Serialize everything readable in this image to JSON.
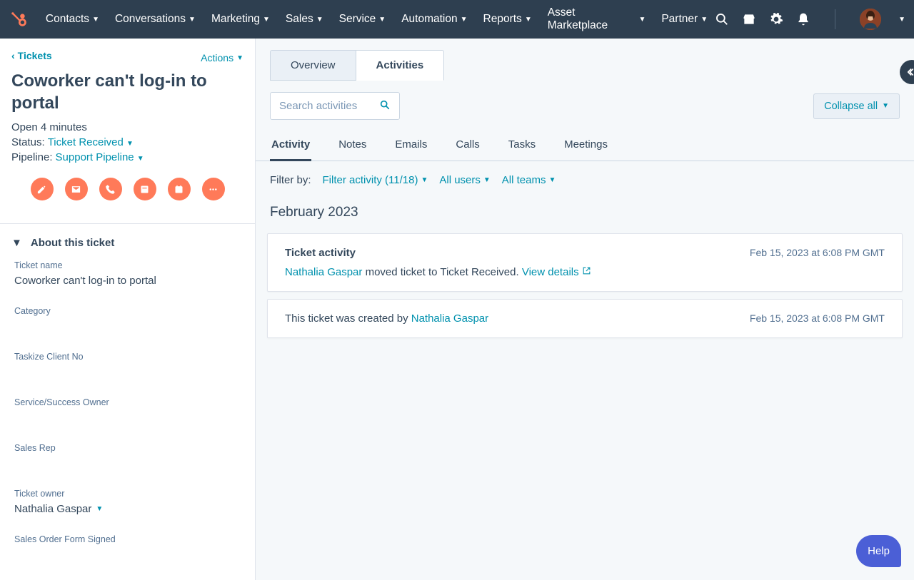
{
  "topnav": {
    "items": [
      "Contacts",
      "Conversations",
      "Marketing",
      "Sales",
      "Service",
      "Automation",
      "Reports",
      "Asset Marketplace",
      "Partner"
    ]
  },
  "sidebar": {
    "back_label": "Tickets",
    "actions_label": "Actions",
    "title": "Coworker can't log-in to portal",
    "open_label": "Open 4 minutes",
    "status_label": "Status:",
    "status_value": "Ticket Received",
    "pipeline_label": "Pipeline:",
    "pipeline_value": "Support Pipeline",
    "about_header": "About this ticket",
    "fields": [
      {
        "label": "Ticket name",
        "value": "Coworker can't log-in to portal"
      },
      {
        "label": "Category",
        "value": ""
      },
      {
        "label": "Taskize Client No",
        "value": ""
      },
      {
        "label": "Service/Success Owner",
        "value": ""
      },
      {
        "label": "Sales Rep",
        "value": ""
      },
      {
        "label": "Ticket owner",
        "value": "Nathalia Gaspar",
        "dropdown": true
      },
      {
        "label": "Sales Order Form Signed",
        "value": ""
      }
    ]
  },
  "main": {
    "tab_overview": "Overview",
    "tab_activities": "Activities",
    "search_placeholder": "Search activities",
    "collapse_label": "Collapse all",
    "activity_tabs": [
      "Activity",
      "Notes",
      "Emails",
      "Calls",
      "Tasks",
      "Meetings"
    ],
    "filter_label": "Filter by:",
    "filter_activity": "Filter activity (11/18)",
    "filter_users": "All users",
    "filter_teams": "All teams",
    "month": "February 2023",
    "card1": {
      "title": "Ticket activity",
      "ts": "Feb 15, 2023 at 6:08 PM GMT",
      "actor": "Nathalia Gaspar",
      "rest": " moved ticket to Ticket Received. ",
      "view": "View details"
    },
    "card2": {
      "line_prefix": "This ticket was created by ",
      "actor": "Nathalia Gaspar",
      "ts": "Feb 15, 2023 at 6:08 PM GMT"
    }
  },
  "help_label": "Help"
}
